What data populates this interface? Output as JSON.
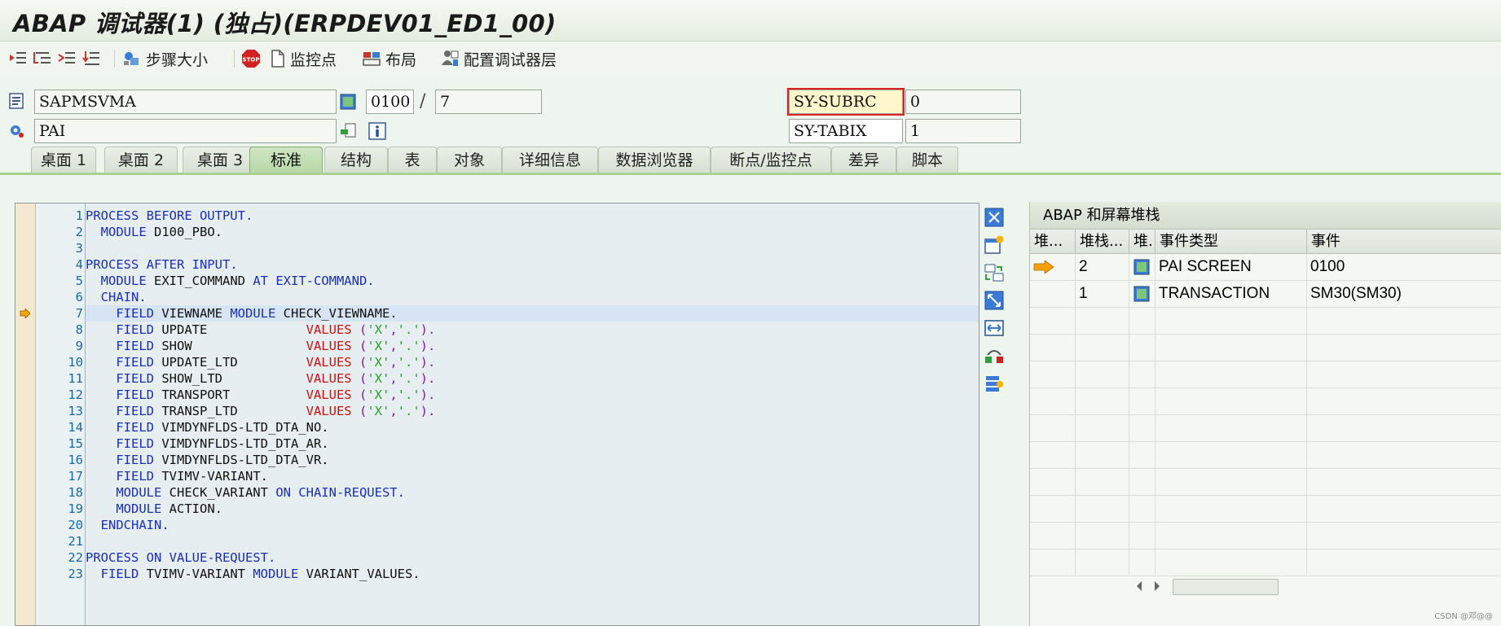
{
  "window": {
    "title": "ABAP 调试器(1) (独占)(ERPDEV01_ED1_00)"
  },
  "toolbar": {
    "step_size": "步骤大小",
    "watchpoint": "监控点",
    "layout": "布局",
    "configure_layers": "配置调试器层"
  },
  "header": {
    "program": "SAPMSVMA",
    "screen": "0100",
    "line": "7",
    "event": "PAI",
    "sysvars": [
      {
        "name": "SY-SUBRC",
        "value": "0"
      },
      {
        "name": "SY-TABIX",
        "value": "1"
      }
    ]
  },
  "tabs": [
    "桌面 1",
    "桌面 2",
    "桌面 3",
    "标准",
    "结构",
    "表",
    "对象",
    "详细信息",
    "数据浏览器",
    "断点/监控点",
    "差异",
    "脚本"
  ],
  "active_tab": "标准",
  "code": {
    "current_line": 7,
    "lines": [
      {
        "n": "1",
        "segs": [
          [
            "PROCESS BEFORE OUTPUT.",
            "kw"
          ]
        ]
      },
      {
        "n": "2",
        "segs": [
          [
            "  ",
            ""
          ],
          [
            "MODULE",
            "kw"
          ],
          [
            " D100_PBO.",
            ""
          ]
        ]
      },
      {
        "n": "3",
        "segs": []
      },
      {
        "n": "4",
        "segs": [
          [
            "PROCESS AFTER INPUT.",
            "kw"
          ]
        ]
      },
      {
        "n": "5",
        "segs": [
          [
            "  ",
            ""
          ],
          [
            "MODULE",
            "kw"
          ],
          [
            " EXIT_COMMAND ",
            ""
          ],
          [
            "AT EXIT-COMMAND.",
            "kw"
          ]
        ]
      },
      {
        "n": "6",
        "segs": [
          [
            "  ",
            ""
          ],
          [
            "CHAIN.",
            "kw"
          ]
        ]
      },
      {
        "n": "7",
        "segs": [
          [
            "    ",
            ""
          ],
          [
            "FIELD",
            "kw"
          ],
          [
            " VIEWNAME ",
            ""
          ],
          [
            "MODULE",
            "kw"
          ],
          [
            " CHECK_VIEWNAME.",
            ""
          ]
        ]
      },
      {
        "n": "8",
        "segs": [
          [
            "    ",
            ""
          ],
          [
            "FIELD",
            "kw"
          ],
          [
            " UPDATE             ",
            ""
          ],
          [
            "VALUES",
            "vk"
          ],
          [
            " (",
            "pu"
          ],
          [
            "'X'",
            "str"
          ],
          [
            ",",
            "pu"
          ],
          [
            "'.'",
            "str"
          ],
          [
            ").",
            "pu"
          ]
        ]
      },
      {
        "n": "9",
        "segs": [
          [
            "    ",
            ""
          ],
          [
            "FIELD",
            "kw"
          ],
          [
            " SHOW               ",
            ""
          ],
          [
            "VALUES",
            "vk"
          ],
          [
            " (",
            "pu"
          ],
          [
            "'X'",
            "str"
          ],
          [
            ",",
            "pu"
          ],
          [
            "'.'",
            "str"
          ],
          [
            ").",
            "pu"
          ]
        ]
      },
      {
        "n": "10",
        "segs": [
          [
            "    ",
            ""
          ],
          [
            "FIELD",
            "kw"
          ],
          [
            " UPDATE_LTD         ",
            ""
          ],
          [
            "VALUES",
            "vk"
          ],
          [
            " (",
            "pu"
          ],
          [
            "'X'",
            "str"
          ],
          [
            ",",
            "pu"
          ],
          [
            "'.'",
            "str"
          ],
          [
            ").",
            "pu"
          ]
        ]
      },
      {
        "n": "11",
        "segs": [
          [
            "    ",
            ""
          ],
          [
            "FIELD",
            "kw"
          ],
          [
            " SHOW_LTD           ",
            ""
          ],
          [
            "VALUES",
            "vk"
          ],
          [
            " (",
            "pu"
          ],
          [
            "'X'",
            "str"
          ],
          [
            ",",
            "pu"
          ],
          [
            "'.'",
            "str"
          ],
          [
            ").",
            "pu"
          ]
        ]
      },
      {
        "n": "12",
        "segs": [
          [
            "    ",
            ""
          ],
          [
            "FIELD",
            "kw"
          ],
          [
            " TRANSPORT          ",
            ""
          ],
          [
            "VALUES",
            "vk"
          ],
          [
            " (",
            "pu"
          ],
          [
            "'X'",
            "str"
          ],
          [
            ",",
            "pu"
          ],
          [
            "'.'",
            "str"
          ],
          [
            ").",
            "pu"
          ]
        ]
      },
      {
        "n": "13",
        "segs": [
          [
            "    ",
            ""
          ],
          [
            "FIELD",
            "kw"
          ],
          [
            " TRANSP_LTD         ",
            ""
          ],
          [
            "VALUES",
            "vk"
          ],
          [
            " (",
            "pu"
          ],
          [
            "'X'",
            "str"
          ],
          [
            ",",
            "pu"
          ],
          [
            "'.'",
            "str"
          ],
          [
            ").",
            "pu"
          ]
        ]
      },
      {
        "n": "14",
        "segs": [
          [
            "    ",
            ""
          ],
          [
            "FIELD",
            "kw"
          ],
          [
            " VIMDYNFLDS-LTD_DTA_NO.",
            ""
          ]
        ]
      },
      {
        "n": "15",
        "segs": [
          [
            "    ",
            ""
          ],
          [
            "FIELD",
            "kw"
          ],
          [
            " VIMDYNFLDS-LTD_DTA_AR.",
            ""
          ]
        ]
      },
      {
        "n": "16",
        "segs": [
          [
            "    ",
            ""
          ],
          [
            "FIELD",
            "kw"
          ],
          [
            " VIMDYNFLDS-LTD_DTA_VR.",
            ""
          ]
        ]
      },
      {
        "n": "17",
        "segs": [
          [
            "    ",
            ""
          ],
          [
            "FIELD",
            "kw"
          ],
          [
            " TVIMV-VARIANT.",
            ""
          ]
        ]
      },
      {
        "n": "18",
        "segs": [
          [
            "    ",
            ""
          ],
          [
            "MODULE",
            "kw"
          ],
          [
            " CHECK_VARIANT ",
            ""
          ],
          [
            "ON CHAIN-REQUEST.",
            "kw"
          ]
        ]
      },
      {
        "n": "19",
        "segs": [
          [
            "    ",
            ""
          ],
          [
            "MODULE",
            "kw"
          ],
          [
            " ACTION.",
            ""
          ]
        ]
      },
      {
        "n": "20",
        "segs": [
          [
            "  ",
            ""
          ],
          [
            "ENDCHAIN.",
            "kw"
          ]
        ]
      },
      {
        "n": "21",
        "segs": []
      },
      {
        "n": "22",
        "segs": [
          [
            "PROCESS ON VALUE-REQUEST.",
            "kw"
          ]
        ]
      },
      {
        "n": "23",
        "segs": [
          [
            "  ",
            ""
          ],
          [
            "FIELD",
            "kw"
          ],
          [
            " TVIMV-VARIANT ",
            ""
          ],
          [
            "MODULE",
            "kw"
          ],
          [
            " VARIANT_VALUES.",
            ""
          ]
        ]
      }
    ]
  },
  "stack_panel": {
    "title": "ABAP 和屏幕堆栈",
    "columns": [
      "堆...",
      "堆栈...",
      "堆.",
      "事件类型",
      "事件"
    ],
    "rows": [
      {
        "depth": "2",
        "event_type": "PAI SCREEN",
        "event": "0100",
        "current": true
      },
      {
        "depth": "1",
        "event_type": "TRANSACTION",
        "event": "SM30(SM30)",
        "current": false
      }
    ]
  },
  "footer": {
    "credit": "CSDN @邓@@"
  },
  "colors": {
    "keyword": "#1a2fb4",
    "values_keyword": "#d01010",
    "string": "#22a322",
    "active_tab": "#b7d8a6",
    "focus_outline": "#e02020"
  }
}
